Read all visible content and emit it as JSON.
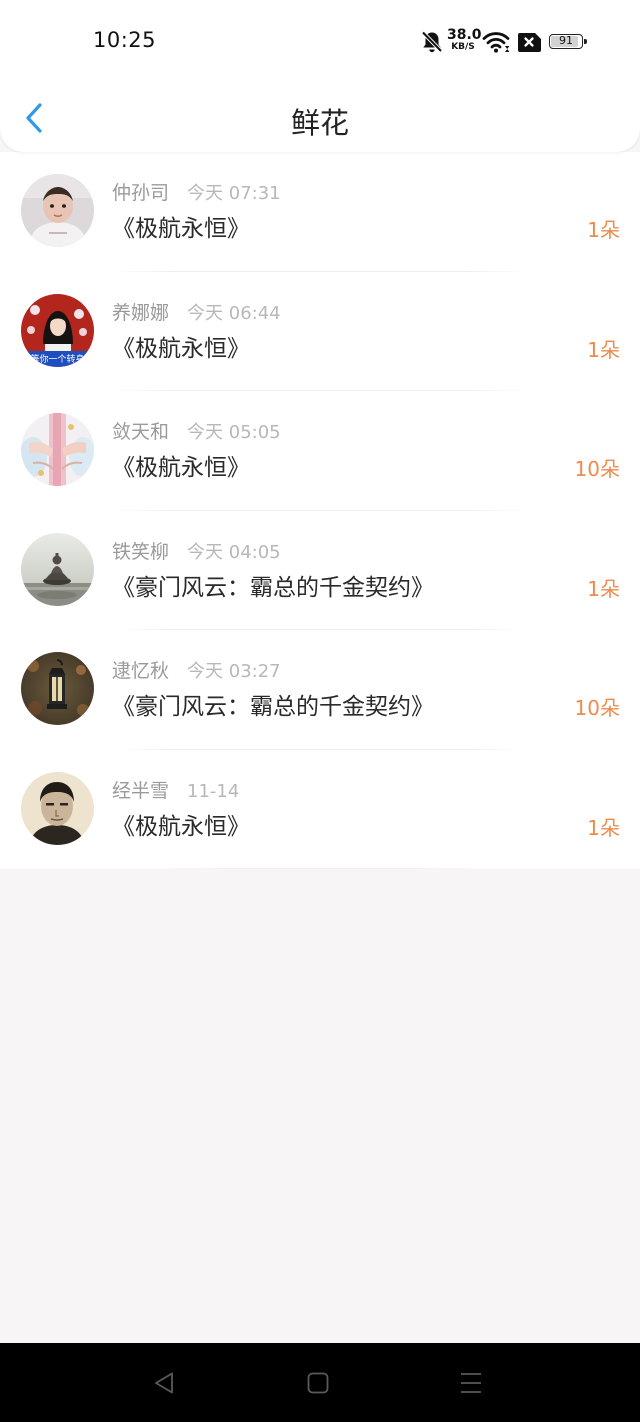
{
  "status_bar": {
    "time": "10:25",
    "net_speed_value": "38.0",
    "net_speed_unit": "KB/S",
    "battery_level": "91",
    "icons": [
      "bell-muted-icon",
      "wifi-icon",
      "sim-x-icon",
      "battery-icon"
    ]
  },
  "nav": {
    "title": "鲜花",
    "back_icon": "chevron-left-icon"
  },
  "colors": {
    "accent_back": "#2e9ae6",
    "count_orange": "#ee8a4c",
    "name_gray": "#9a9a9a",
    "time_gray": "#b8b8b8",
    "title_dark": "#2a2a2a",
    "page_bg": "#f7f5f6"
  },
  "items": [
    {
      "name": "仲孙司",
      "time": "今天 07:31",
      "book": "《极航永恒》",
      "count": "1朵",
      "avatar": "baby-photo"
    },
    {
      "name": "养娜娜",
      "time": "今天 06:44",
      "book": "《极航永恒》",
      "count": "1朵",
      "avatar": "girl-photo",
      "avatar_text": "等你一个转身"
    },
    {
      "name": "敛天和",
      "time": "今天 05:05",
      "book": "《极航永恒》",
      "count": "10朵",
      "avatar": "holding-hands"
    },
    {
      "name": "铁笑柳",
      "time": "今天 04:05",
      "book": "《豪门风云：霸总的千金契约》",
      "count": "1朵",
      "avatar": "buddha-statue"
    },
    {
      "name": "逮忆秋",
      "time": "今天 03:27",
      "book": "《豪门风云：霸总的千金契约》",
      "count": "10朵",
      "avatar": "lantern"
    },
    {
      "name": "经半雪",
      "time": "11-14",
      "book": "《极航永恒》",
      "count": "1朵",
      "avatar": "man-portrait"
    }
  ],
  "system_nav": {
    "back": "triangle-back-icon",
    "home": "square-home-icon",
    "menu": "menu-lines-icon"
  }
}
